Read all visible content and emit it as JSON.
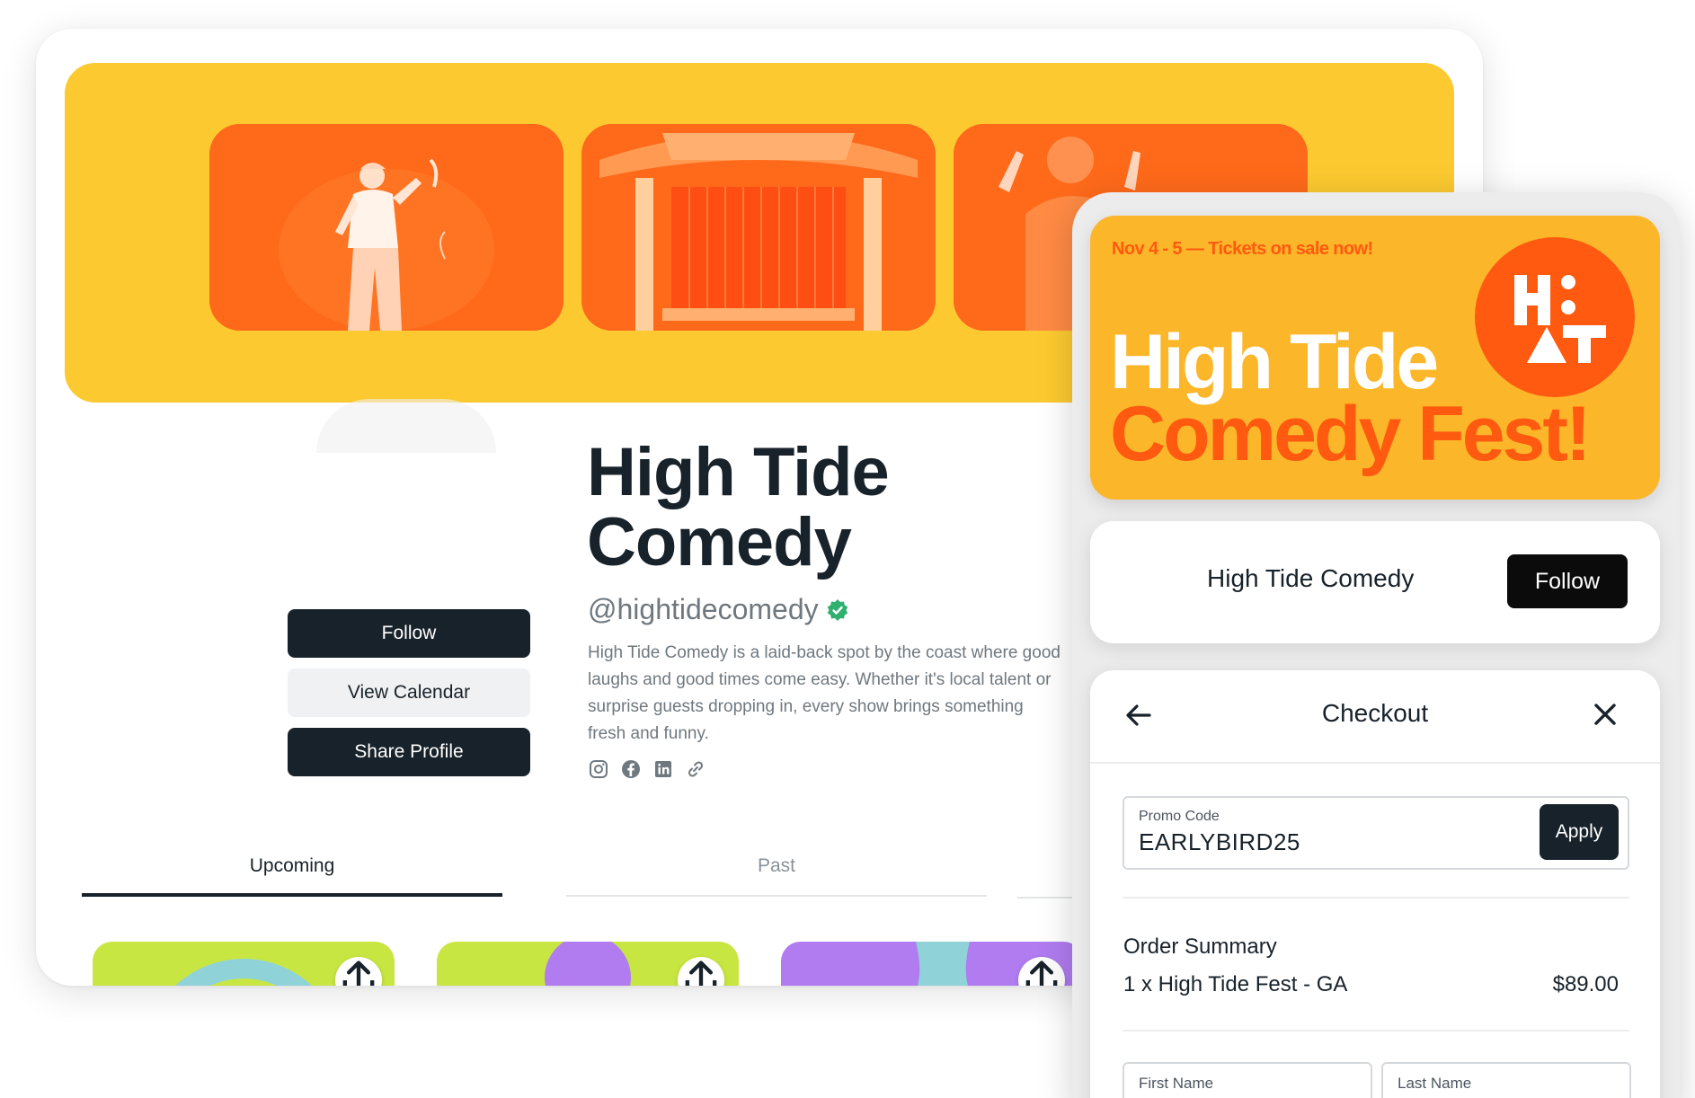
{
  "profile": {
    "title_line1": "High Tide",
    "title_line2": "Comedy",
    "handle": "@hightidecomedy",
    "bio": "High Tide Comedy is a laid-back spot by the coast where good laughs and good times come easy. Whether it's local talent or surprise guests dropping in, every show brings something fresh and funny.",
    "socials": [
      "instagram-icon",
      "facebook-icon",
      "linkedin-icon",
      "link-icon"
    ],
    "buttons": {
      "follow": "Follow",
      "view_calendar": "View Calendar",
      "share_profile": "Share Profile"
    },
    "tabs": [
      {
        "label": "Upcoming",
        "active": true
      },
      {
        "label": "Past",
        "active": false
      }
    ]
  },
  "colors": {
    "banner": "#fcca30",
    "photo_tint": "#ff6a1a",
    "dark": "#18222a",
    "accent_orange": "#ff5a10",
    "verified_green": "#2fb06e"
  },
  "promo": {
    "date_line": "Nov 4 - 5 — Tickets on sale now!",
    "line1": "High Tide",
    "line2": "Comedy Fest!",
    "logo_text": "HT"
  },
  "follow_strip": {
    "name": "High Tide Comedy",
    "button": "Follow"
  },
  "checkout": {
    "title": "Checkout",
    "promo_label": "Promo Code",
    "promo_value": "EARLYBIRD25",
    "apply": "Apply",
    "order_title": "Order Summary",
    "item": "1 x High Tide Fest - GA",
    "price": "$89.00",
    "first_name_placeholder": "First Name",
    "last_name_placeholder": "Last Name"
  }
}
